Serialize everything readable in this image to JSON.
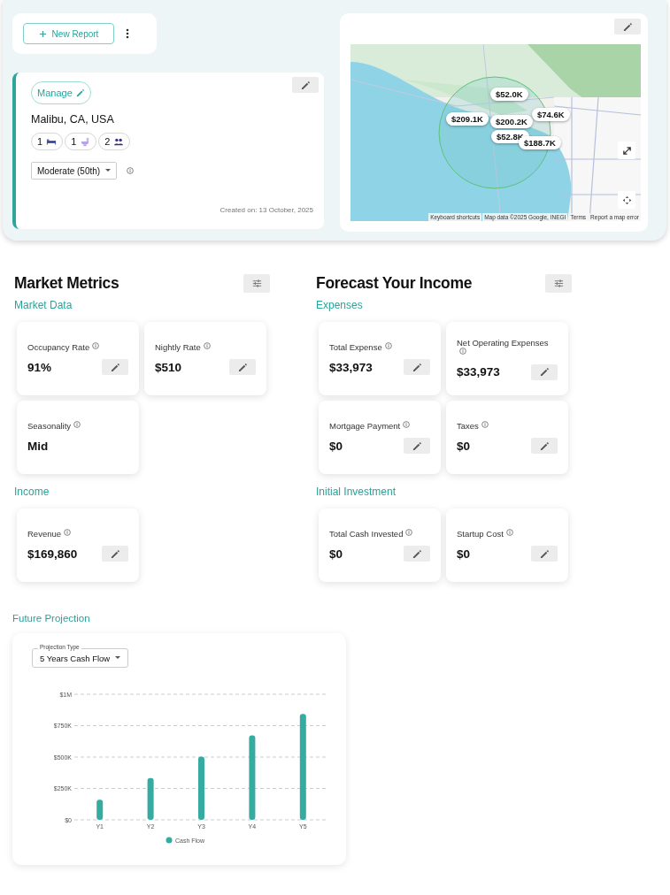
{
  "toolbar": {
    "new_report_button": "New Report"
  },
  "property_card": {
    "manage_button": "Manage",
    "location": "Malibu, CA, USA",
    "chips": [
      {
        "count": "1",
        "kind": "bed"
      },
      {
        "count": "1",
        "kind": "bath"
      },
      {
        "count": "2",
        "kind": "guests"
      }
    ],
    "percentile_select": "Moderate (50th)",
    "created": "Created on: 13 October, 2025"
  },
  "map": {
    "markers": [
      {
        "label": "$52.0K"
      },
      {
        "label": "$209.1K"
      },
      {
        "label": "$200.2K"
      },
      {
        "label": "$74.6K"
      },
      {
        "label": "$52.8K"
      },
      {
        "label": "$188.7K"
      }
    ],
    "attribution": [
      "Keyboard shortcuts",
      "Map data ©2025 Google, INEGI",
      "Terms",
      "Report a map error"
    ]
  },
  "sections": [
    {
      "title": "Market Metrics",
      "groups": [
        {
          "title": "Market Data",
          "cards": [
            {
              "label": "Occupancy Rate",
              "value": "91%",
              "editable": true
            },
            {
              "label": "Nightly Rate",
              "value": "$510",
              "editable": true
            },
            {
              "label": "Seasonality",
              "value": "Mid",
              "editable": false
            }
          ]
        },
        {
          "title": "Income",
          "cards": [
            {
              "label": "Revenue",
              "value": "$169,860",
              "editable": true
            }
          ]
        }
      ]
    },
    {
      "title": "Forecast Your Income",
      "groups": [
        {
          "title": "Expenses",
          "cards": [
            {
              "label": "Total Expense",
              "value": "$33,973",
              "editable": true
            },
            {
              "label": "Net Operating Expenses",
              "value": "$33,973",
              "editable": true
            },
            {
              "label": "Mortgage Payment",
              "value": "$0",
              "editable": true
            },
            {
              "label": "Taxes",
              "value": "$0",
              "editable": true
            }
          ]
        },
        {
          "title": "Initial Investment",
          "cards": [
            {
              "label": "Total Cash Invested",
              "value": "$0",
              "editable": true
            },
            {
              "label": "Startup Cost",
              "value": "$0",
              "editable": true
            }
          ]
        }
      ]
    }
  ],
  "projection": {
    "title": "Future Projection",
    "select_label": "Projection Type",
    "select_value": "5 Years Cash Flow",
    "chart_data": {
      "type": "bar",
      "categories": [
        "Y1",
        "Y2",
        "Y3",
        "Y4",
        "Y5"
      ],
      "series": [
        {
          "name": "Cash Flow",
          "color": "#36aba1",
          "values": [
            160000,
            333000,
            503000,
            672000,
            843000
          ]
        }
      ],
      "grid": true,
      "ylim": [
        0,
        1000000
      ],
      "yticks": [
        {
          "value": 0,
          "label": "$0"
        },
        {
          "value": 250000,
          "label": "$250K"
        },
        {
          "value": 500000,
          "label": "$500K"
        },
        {
          "value": 750000,
          "label": "$750K"
        },
        {
          "value": 1000000,
          "label": "$1M"
        }
      ]
    }
  }
}
